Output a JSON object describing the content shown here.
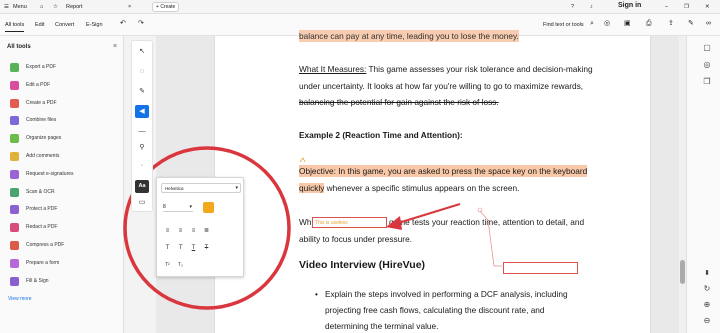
{
  "titlebar": {
    "menu": "Menu",
    "doc_tab": "Report",
    "create": "Create",
    "sign_in": "Sign in"
  },
  "menubar": {
    "tabs": [
      "All tools",
      "Edit",
      "Convert",
      "E-Sign"
    ],
    "find": "Find text or tools"
  },
  "leftpanel": {
    "title": "All tools",
    "tools": [
      {
        "label": "Export a PDF",
        "color": "#57b35a"
      },
      {
        "label": "Edit a PDF",
        "color": "#d94f9e"
      },
      {
        "label": "Create a PDF",
        "color": "#e25b4e"
      },
      {
        "label": "Combine files",
        "color": "#7a6ad8"
      },
      {
        "label": "Organize pages",
        "color": "#6bbd4a"
      },
      {
        "label": "Add comments",
        "color": "#e0b23a"
      },
      {
        "label": "Request e-signatures",
        "color": "#9a64d6"
      },
      {
        "label": "Scan & OCR",
        "color": "#4aa36f"
      },
      {
        "label": "Protect a PDF",
        "color": "#8b61d1"
      },
      {
        "label": "Redact a PDF",
        "color": "#d84b7d"
      },
      {
        "label": "Compress a PDF",
        "color": "#d95c4a"
      },
      {
        "label": "Prepare a form",
        "color": "#b668d8"
      },
      {
        "label": "Fill & Sign",
        "color": "#8a5fd0"
      }
    ],
    "view_more": "View more"
  },
  "popup": {
    "font": "Helvetica",
    "size": "8",
    "color": "#f2a81d"
  },
  "document": {
    "line0": "balance can pay at any time, leading you to lose the money.",
    "what_label": "What It Measures:",
    "what_text": " This game assesses your risk tolerance and decision-making",
    "line2": "under uncertainty. It looks at how far you're willing to go to maximize rewards,",
    "line3": "balancing the potential for gain against the risk of loss.",
    "example2": "Example 2 (Reaction Time and Attention):",
    "objective_hl": "Objective: In this game, you are asked to press the space key on the keyboard",
    "quickly_hl": "quickly",
    "objective_rest": " whenever a specific stimulus appears on the screen.",
    "wh": "Wh",
    "typed": "This is useless",
    "wh_rest": "game tests your reaction time, attention to detail, and",
    "ability": "ability to focus under pressure.",
    "video_heading": "Video Interview (HireVue)",
    "bullet1": "Explain the steps involved in performing a DCF analysis, including",
    "bullet2": "projecting free cash flows, calculating the discount rate, and",
    "bullet3": "determining the terminal value."
  },
  "colors": {
    "accent": "#1473e6",
    "highlight": "#f8c8a8",
    "annotation_red": "#d9363e"
  }
}
